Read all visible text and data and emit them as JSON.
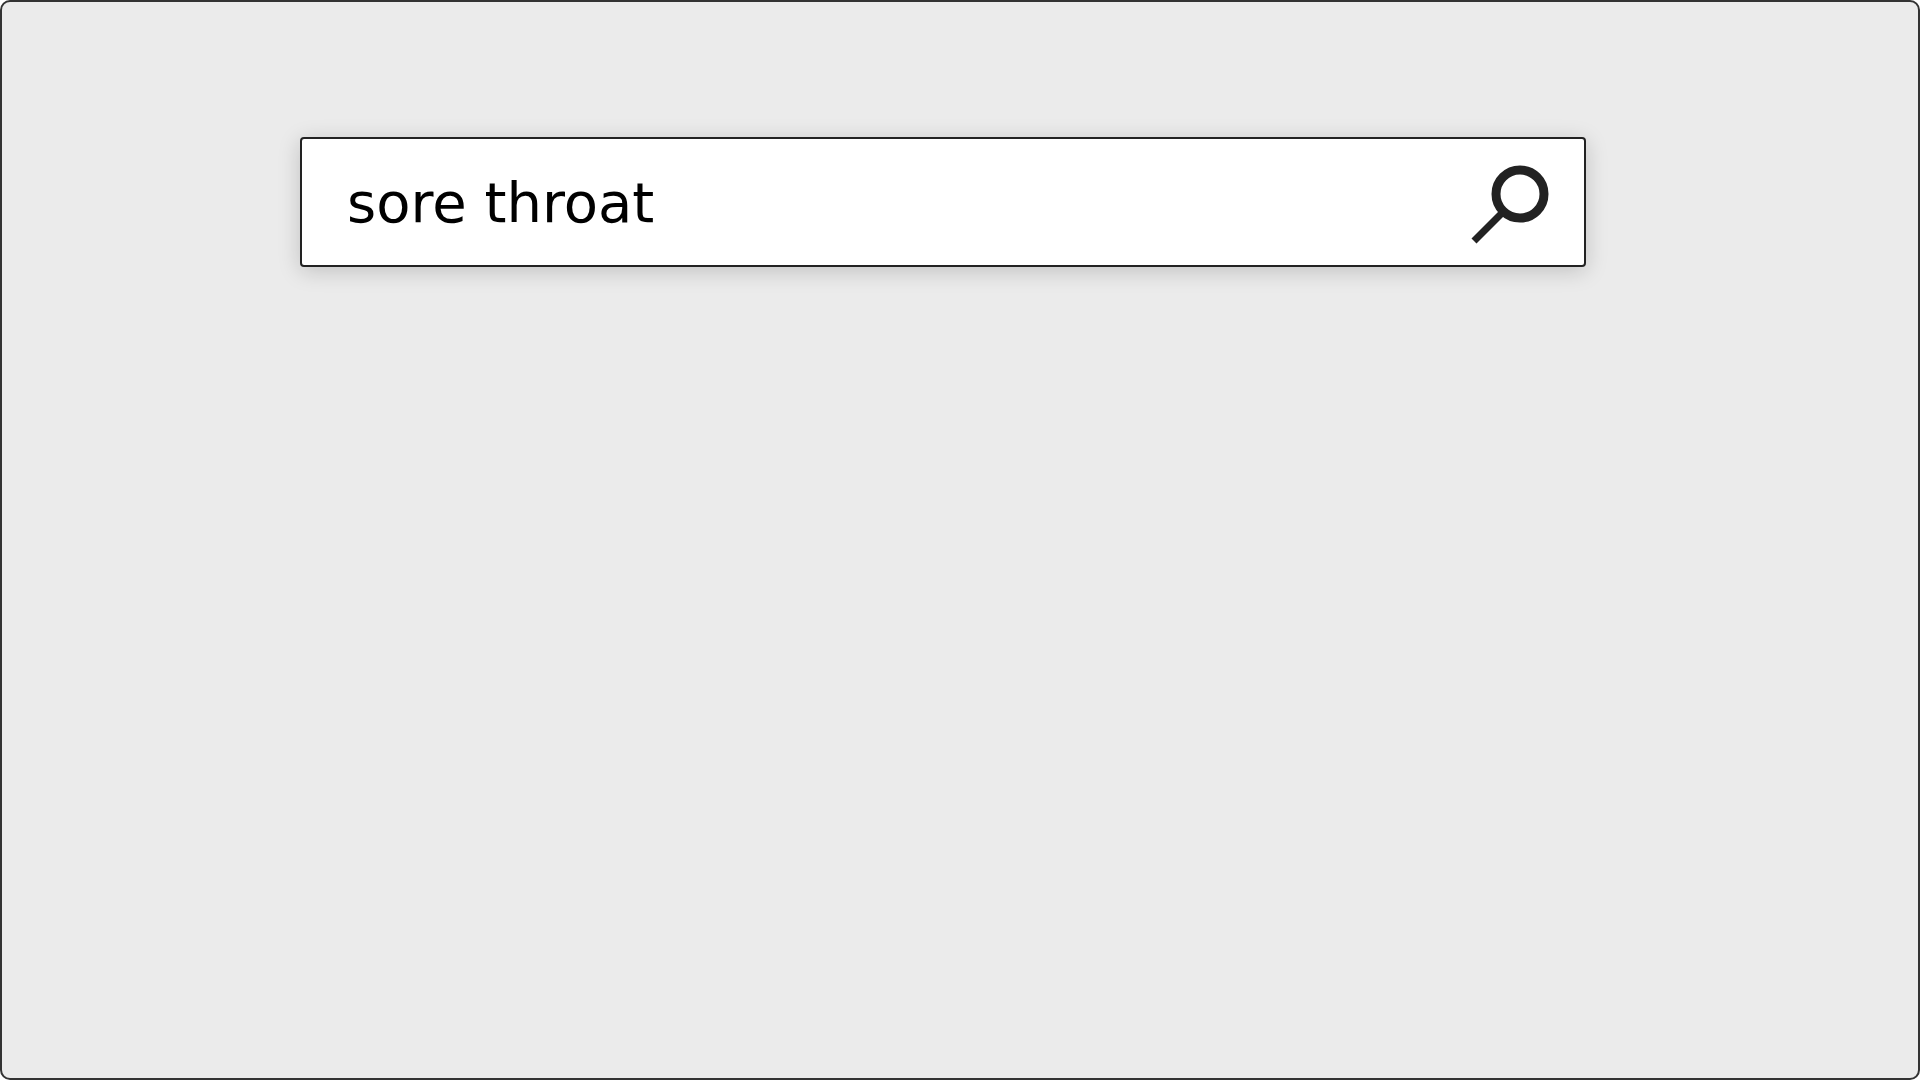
{
  "search": {
    "value": "sore throat"
  }
}
